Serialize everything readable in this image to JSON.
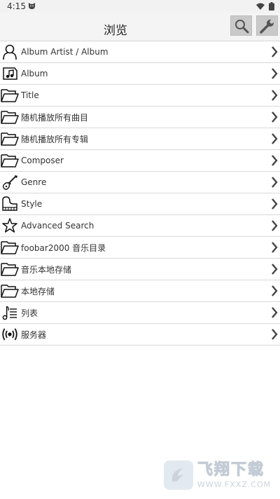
{
  "status_bar": {
    "time": "4:15"
  },
  "header": {
    "title": "浏览"
  },
  "items": [
    {
      "label": "Album Artist / Album",
      "icon": "person-icon"
    },
    {
      "label": "Album",
      "icon": "album-icon"
    },
    {
      "label": "Title",
      "icon": "folder-icon"
    },
    {
      "label": "随机播放所有曲目",
      "icon": "folder-icon"
    },
    {
      "label": "随机播放所有专辑",
      "icon": "folder-icon"
    },
    {
      "label": "Composer",
      "icon": "folder-icon"
    },
    {
      "label": "Genre",
      "icon": "guitar-icon"
    },
    {
      "label": "Style",
      "icon": "piano-icon"
    },
    {
      "label": "Advanced Search",
      "icon": "star-icon"
    },
    {
      "label": "foobar2000 音乐目录",
      "icon": "folder-icon"
    },
    {
      "label": "音乐本地存储",
      "icon": "folder-icon"
    },
    {
      "label": "本地存储",
      "icon": "folder-icon"
    },
    {
      "label": "列表",
      "icon": "playlist-icon"
    },
    {
      "label": "服务器",
      "icon": "broadcast-icon"
    }
  ],
  "watermark": {
    "text": "飞翔下载",
    "url": "WWW.FXXZ.COM"
  }
}
